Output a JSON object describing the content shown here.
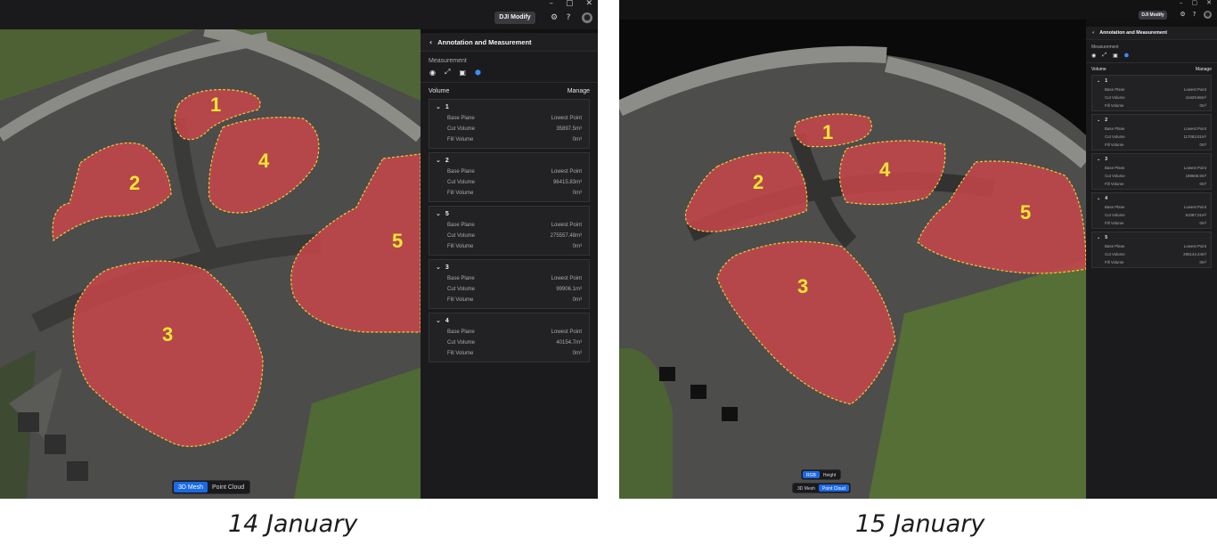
{
  "window_controls": [
    "–",
    "▢",
    "✕"
  ],
  "header": {
    "modify_label": "DJI Modify"
  },
  "panel": {
    "title": "Annotation and Measurement",
    "measurement_label": "Measurement",
    "volume_label": "Volume",
    "manage_label": "Manage",
    "row_labels": {
      "base_plane": "Base Plane",
      "cut_volume": "Cut Volume",
      "fill_volume": "Fill Volume"
    }
  },
  "left": {
    "caption": "14 January",
    "items": [
      {
        "id": "1",
        "base_plane": "Lowest Point",
        "cut_volume": "35897.5m³",
        "fill_volume": "0m³"
      },
      {
        "id": "2",
        "base_plane": "Lowest Point",
        "cut_volume": "96415.83m³",
        "fill_volume": "0m³"
      },
      {
        "id": "5",
        "base_plane": "Lowest Point",
        "cut_volume": "275557.48m³",
        "fill_volume": "0m³"
      },
      {
        "id": "3",
        "base_plane": "Lowest Point",
        "cut_volume": "99906.1m³",
        "fill_volume": "0m³"
      },
      {
        "id": "4",
        "base_plane": "Lowest Point",
        "cut_volume": "40154.7m³",
        "fill_volume": "0m³"
      }
    ],
    "view_toggle": {
      "mesh": "3D Mesh",
      "cloud": "Point Cloud",
      "active": "mesh"
    },
    "pile_labels": [
      "1",
      "2",
      "3",
      "4",
      "5"
    ]
  },
  "right": {
    "caption": "15 January",
    "items": [
      {
        "id": "1",
        "base_plane": "Lowest Point",
        "cut_volume": "41629.66m³",
        "fill_volume": "0m³"
      },
      {
        "id": "2",
        "base_plane": "Lowest Point",
        "cut_volume": "117083.01m³",
        "fill_volume": "0m³"
      },
      {
        "id": "3",
        "base_plane": "Lowest Point",
        "cut_volume": "198605.9m³",
        "fill_volume": "0m³"
      },
      {
        "id": "4",
        "base_plane": "Lowest Point",
        "cut_volume": "61087.01m³",
        "fill_volume": "0m³"
      },
      {
        "id": "5",
        "base_plane": "Lowest Point",
        "cut_volume": "290144.24m³",
        "fill_volume": "0m³"
      }
    ],
    "color_toggle": {
      "rgb": "RGB",
      "height": "Height",
      "active": "rgb"
    },
    "view_toggle": {
      "mesh": "3D Mesh",
      "cloud": "Point Cloud",
      "active": "cloud"
    },
    "pile_labels": [
      "1",
      "2",
      "3",
      "4",
      "5"
    ]
  },
  "icons": [
    "back-chevron-icon",
    "point-tool-icon",
    "line-tool-icon",
    "area-tool-icon",
    "volume-tool-icon",
    "settings-icon",
    "help-icon",
    "avatar-icon",
    "collapse-chevron-icon"
  ],
  "colors": {
    "accent": "#1a6ae6",
    "pile_fill": "#c8474a",
    "pile_outline": "#f0c83a",
    "label": "#f5e633"
  }
}
